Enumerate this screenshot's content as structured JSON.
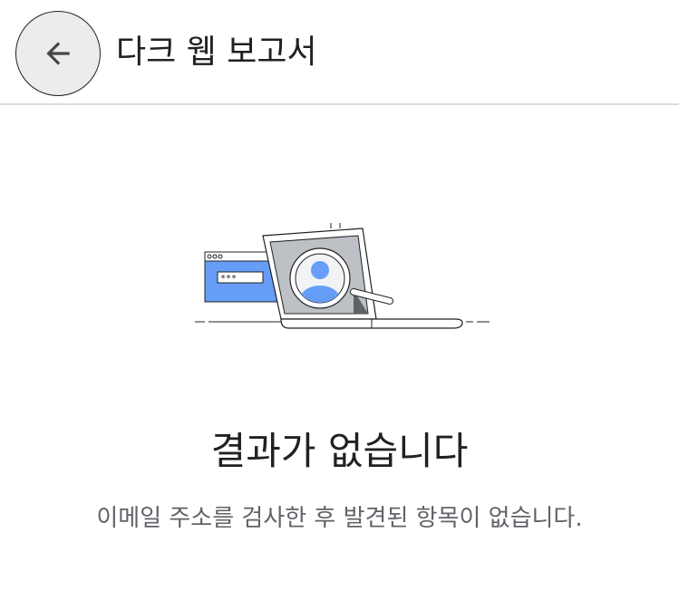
{
  "header": {
    "back_icon": "arrow-back-icon",
    "title": "다크 웹 보고서"
  },
  "illustration": {
    "name": "laptop-magnifier-illustration",
    "password_mask": "***",
    "colors": {
      "accent": "#669df6",
      "screen": "#bdc1c6",
      "dark": "#5f6368",
      "outline": "#202124"
    }
  },
  "empty_state": {
    "title": "결과가 없습니다",
    "description": "이메일 주소를 검사한 후 발견된 항목이 없습니다."
  }
}
